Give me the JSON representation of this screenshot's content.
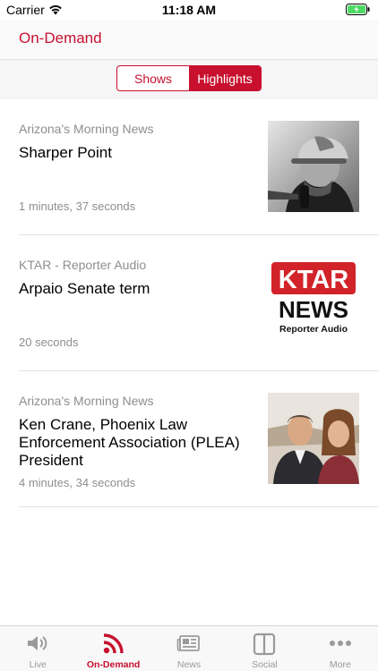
{
  "status_bar": {
    "carrier": "Carrier",
    "time": "11:18 AM"
  },
  "header": {
    "title": "On-Demand"
  },
  "segments": [
    {
      "label": "Shows",
      "active": false
    },
    {
      "label": "Highlights",
      "active": true
    }
  ],
  "items": [
    {
      "show": "Arizona's Morning News",
      "title": "Sharper Point",
      "duration": "1 minutes, 37 seconds",
      "thumb": "host-in-cap-photo"
    },
    {
      "show": "KTAR - Reporter Audio",
      "title": "Arpaio Senate term",
      "duration": "20 seconds",
      "thumb": "ktar-news-logo",
      "logo": {
        "line1": "KTAR",
        "line2": "NEWS",
        "line3": "Reporter Audio"
      }
    },
    {
      "show": "Arizona's Morning News",
      "title": "Ken Crane, Phoenix Law Enforcement Association (PLEA) President",
      "duration": "4 minutes, 34 seconds",
      "thumb": "guests-photo"
    }
  ],
  "tabs": [
    {
      "label": "Live",
      "icon": "speaker-icon"
    },
    {
      "label": "On-Demand",
      "icon": "rss-icon",
      "active": true
    },
    {
      "label": "News",
      "icon": "newspaper-icon"
    },
    {
      "label": "Social",
      "icon": "columns-icon"
    },
    {
      "label": "More",
      "icon": "more-dots-icon"
    }
  ],
  "colors": {
    "accent": "#c8102e",
    "secondary_text": "#8e8e93"
  }
}
